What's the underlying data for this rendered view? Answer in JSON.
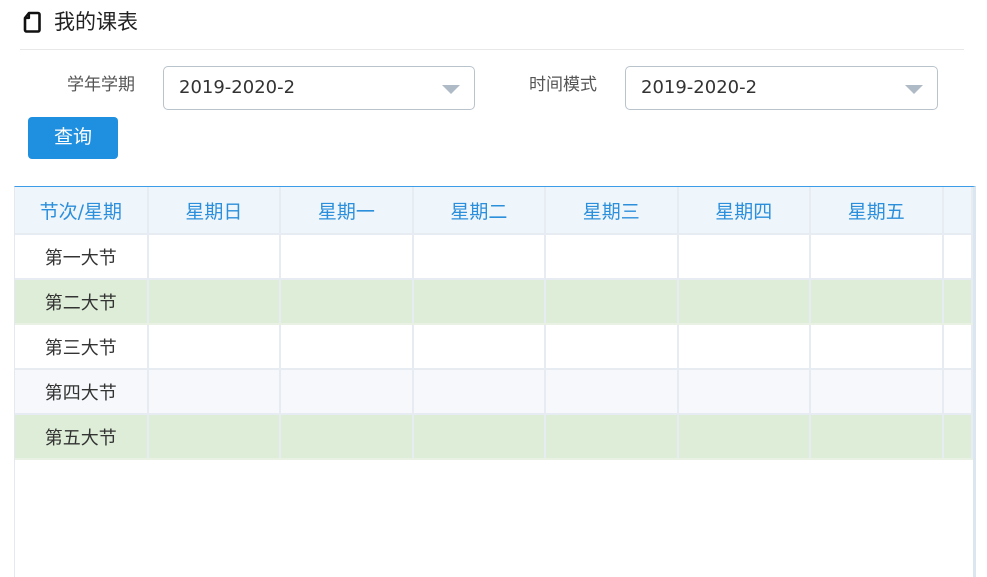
{
  "header": {
    "title": "我的课表",
    "icon": "document-icon"
  },
  "filters": {
    "term_label": "学年学期",
    "term_value": "2019-2020-2",
    "mode_label": "时间模式",
    "mode_value": "2019-2020-2"
  },
  "query_button": {
    "label": "查询",
    "color": "#1f8fe0"
  },
  "timetable": {
    "headers": [
      "节次/星期",
      "星期日",
      "星期一",
      "星期二",
      "星期三",
      "星期四",
      "星期五"
    ],
    "rows": [
      "第一大节",
      "第二大节",
      "第三大节",
      "第四大节",
      "第五大节"
    ]
  },
  "colors": {
    "header_text": "#2c8fdb",
    "header_bg": "#eef5fb",
    "green_row": "#ddedd7",
    "accent_border": "#3d9ce8"
  }
}
